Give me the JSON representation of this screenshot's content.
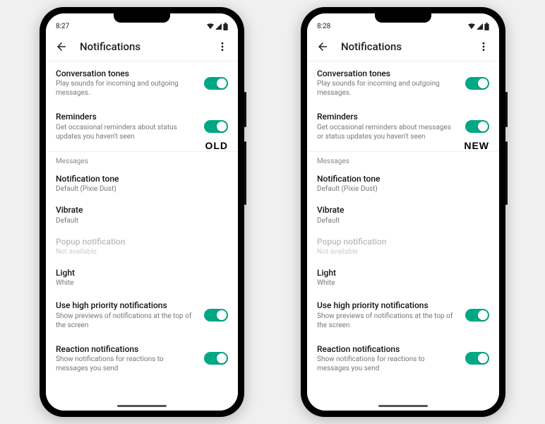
{
  "phones": [
    {
      "label": "OLD",
      "status_time": "8:27",
      "header_title": "Notifications",
      "items": {
        "conv_tones_title": "Conversation tones",
        "conv_tones_sub": "Play sounds for incoming and outgoing messages.",
        "reminders_title": "Reminders",
        "reminders_sub": "Get occasional reminders about status updates you haven't seen",
        "section_messages": "Messages",
        "notif_tone_title": "Notification tone",
        "notif_tone_sub": "Default (Pixie Dust)",
        "vibrate_title": "Vibrate",
        "vibrate_sub": "Default",
        "popup_title": "Popup notification",
        "popup_sub": "Not available",
        "light_title": "Light",
        "light_sub": "White",
        "high_prio_title": "Use high priority notifications",
        "high_prio_sub": "Show previews of notifications at the top of the screen",
        "reaction_title": "Reaction notifications",
        "reaction_sub": "Show notifications for reactions to messages you send"
      }
    },
    {
      "label": "NEW",
      "status_time": "8:28",
      "header_title": "Notifications",
      "items": {
        "conv_tones_title": "Conversation tones",
        "conv_tones_sub": "Play sounds for incoming and outgoing messages.",
        "reminders_title": "Reminders",
        "reminders_sub": "Get occasional reminders about messages or status updates you haven't seen",
        "section_messages": "Messages",
        "notif_tone_title": "Notification tone",
        "notif_tone_sub": "Default (Pixie Dust)",
        "vibrate_title": "Vibrate",
        "vibrate_sub": "Default",
        "popup_title": "Popup notification",
        "popup_sub": "Not available",
        "light_title": "Light",
        "light_sub": "White",
        "high_prio_title": "Use high priority notifications",
        "high_prio_sub": "Show previews of notifications at the top of the screen",
        "reaction_title": "Reaction notifications",
        "reaction_sub": "Show notifications for reactions to messages you send"
      }
    }
  ],
  "colors": {
    "accent": "#00a884"
  }
}
